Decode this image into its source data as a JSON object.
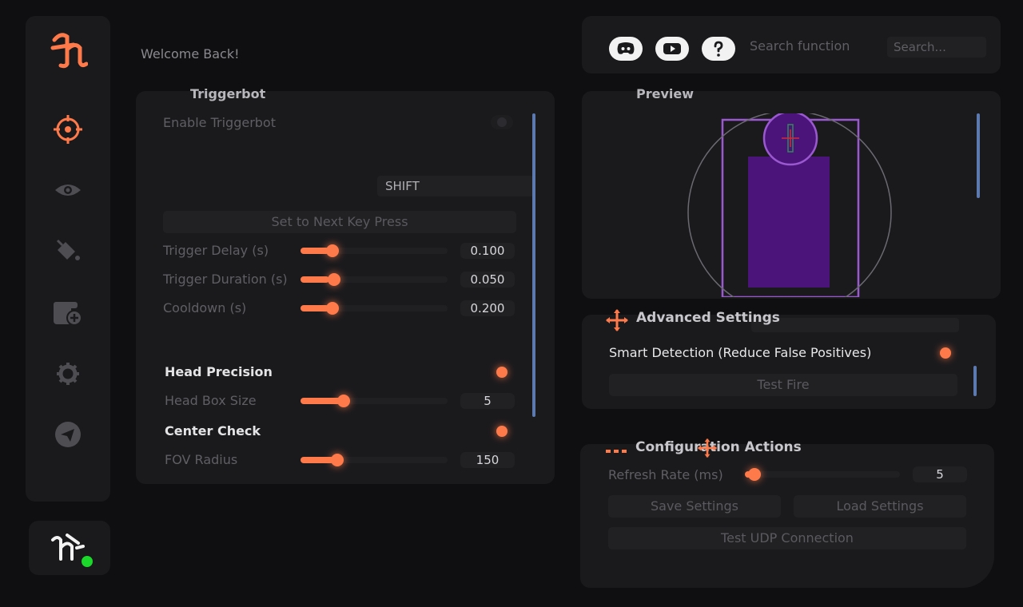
{
  "welcome": "Welcome Back!",
  "sidebar": {
    "items": [
      {
        "name": "crosshair-icon",
        "active": true
      },
      {
        "name": "eye-icon",
        "active": false
      },
      {
        "name": "paint-bucket-icon",
        "active": false
      },
      {
        "name": "config-add-icon",
        "active": false
      },
      {
        "name": "gear-icon",
        "active": false
      },
      {
        "name": "send-icon",
        "active": false
      }
    ],
    "accent": "#ff7a4a"
  },
  "status": {
    "online_color": "#1bd82a"
  },
  "header": {
    "icons": [
      "discord-icon",
      "youtube-icon",
      "help-icon"
    ],
    "search_label": "Search function",
    "search_placeholder": "Search..."
  },
  "triggerbot": {
    "title": "Triggerbot",
    "enable_label": "Enable Triggerbot",
    "enable_on": false,
    "key": "SHIFT",
    "set_key_button": "Set to Next Key Press",
    "sliders": [
      {
        "label": "Trigger Delay (s)",
        "value": "0.100",
        "fraction": 0.2
      },
      {
        "label": "Trigger Duration (s)",
        "value": "0.050",
        "fraction": 0.2
      },
      {
        "label": "Cooldown (s)",
        "value": "0.200",
        "fraction": 0.2
      }
    ],
    "head_precision_label": "Head Precision",
    "head_precision_on": true,
    "head_box_label": "Head Box Size",
    "head_box_value": "5",
    "head_box_fraction": 0.28,
    "center_check_label": "Center Check",
    "center_check_on": true,
    "fov_label": "FOV Radius",
    "fov_value": "150",
    "fov_fraction": 0.23
  },
  "preview": {
    "title": "Preview",
    "box_color": "#9b59d0",
    "body_color": "#4a147a"
  },
  "advanced": {
    "title": "Advanced Settings",
    "smart_detection_label": "Smart Detection (Reduce False Positives)",
    "smart_detection_on": true,
    "test_fire_button": "Test Fire"
  },
  "config": {
    "title": "Configuration Actions",
    "refresh_label": "Refresh Rate (ms)",
    "refresh_value": "5",
    "refresh_fraction": 0.02,
    "save_button": "Save Settings",
    "load_button": "Load Settings",
    "udp_button": "Test UDP Connection"
  }
}
